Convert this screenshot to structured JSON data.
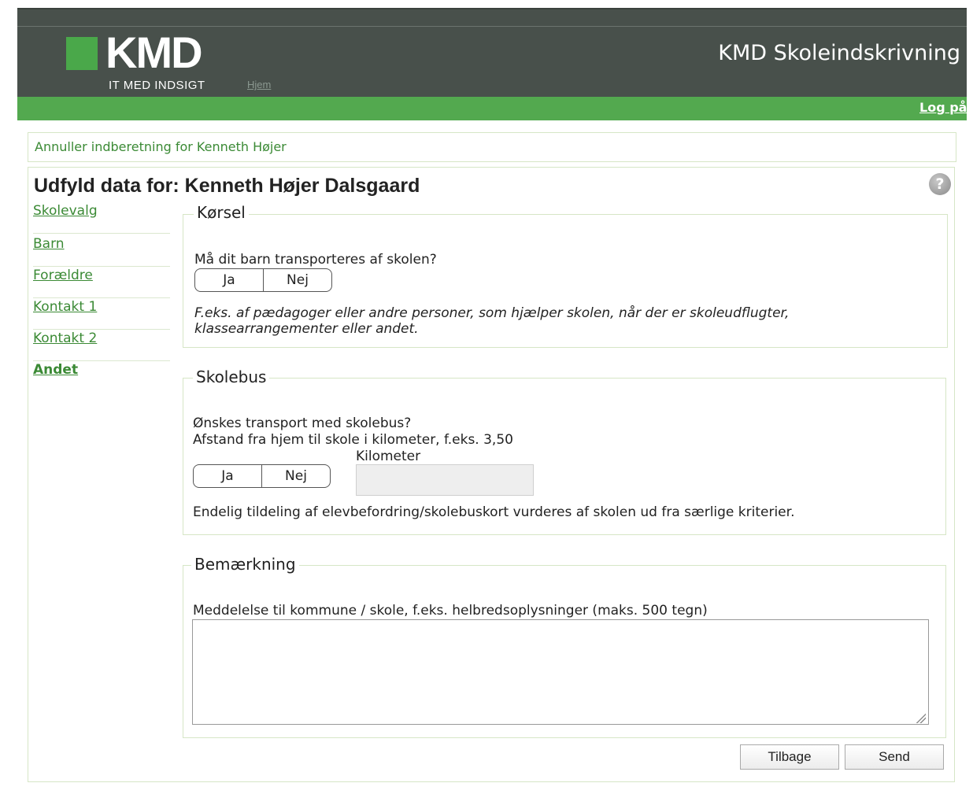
{
  "header": {
    "logo_text": "KMD",
    "tagline": "IT MED INDSIGT",
    "home_link": "Hjem",
    "app_title": "KMD Skoleindskrivning",
    "login_link": "Log på"
  },
  "cancel_link": "Annuller indberetning for Kenneth Højer",
  "page_title": "Udfyld data for: Kenneth Højer Dalsgaard",
  "help_icon": "?",
  "nav": {
    "items": [
      {
        "label": "Skolevalg"
      },
      {
        "label": "Barn"
      },
      {
        "label": "Forældre"
      },
      {
        "label": "Kontakt 1"
      },
      {
        "label": "Kontakt 2"
      },
      {
        "label": "Andet"
      }
    ]
  },
  "korsel": {
    "legend": "Kørsel",
    "question": "Må dit barn transporteres af skolen?",
    "yes": "Ja",
    "no": "Nej",
    "note_line1": "F.eks. af pædagoger eller andre personer, som hjælper skolen, når der er skoleudflugter,",
    "note_line2": "klassearrangementer eller andet."
  },
  "skolebus": {
    "legend": "Skolebus",
    "question": "Ønskes transport med skolebus?",
    "distance_label": "Afstand fra hjem til skole i kilometer, f.eks. 3,50",
    "km_label": "Kilometer",
    "km_value": "",
    "yes": "Ja",
    "no": "Nej",
    "final_note": "Endelig tildeling af elevbefordring/skolebuskort vurderes af skolen ud fra særlige kriterier."
  },
  "bemaerkning": {
    "legend": "Bemærkning",
    "label": "Meddelelse til kommune / skole, f.eks. helbredsoplysninger (maks. 500 tegn)",
    "value": ""
  },
  "buttons": {
    "back": "Tilbage",
    "send": "Send"
  },
  "colors": {
    "header_bg": "#48504b",
    "accent_green": "#53a94f",
    "link_green": "#3b8a35"
  }
}
